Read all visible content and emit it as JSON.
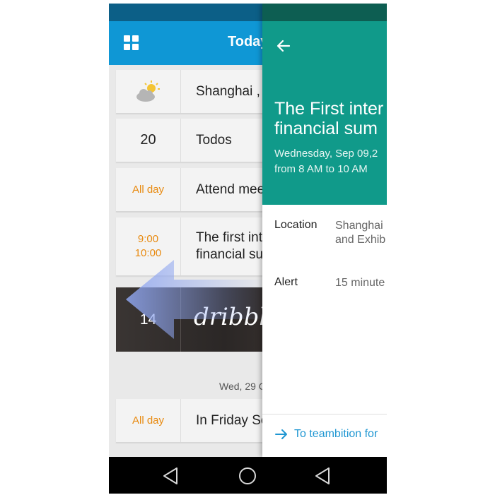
{
  "appbar": {
    "title": "Today"
  },
  "list": {
    "rows": [
      {
        "left": "",
        "right": "Shanghai ,"
      },
      {
        "left": "20",
        "right": "Todos"
      },
      {
        "left": "All day",
        "right": "Attend mee"
      },
      {
        "left_start": "9:00",
        "left_end": "10:00",
        "right_line1": "The first int",
        "right_line2": "financial su"
      },
      {
        "left": "14",
        "right": "dribbble"
      }
    ],
    "date_separator": "Wed, 29 C",
    "after_separator": [
      {
        "left": "All day",
        "right": "In Friday Se"
      }
    ]
  },
  "detail": {
    "title_line1": "The First inter",
    "title_line2": "financial  sum",
    "date_line1": "Wednesday, Sep 09,2",
    "date_line2": "from 8 AM to 10 AM",
    "location_label": "Location",
    "location_value_line1": "Shanghai",
    "location_value_line2": "and Exhib",
    "alert_label": "Alert",
    "alert_value": "15 minute",
    "link_label": "To teambition for"
  },
  "icons": {
    "grid": "grid-icon",
    "weather": "partly-cloudy-icon",
    "back": "arrow-left-icon",
    "swipe": "swipe-left-arrow-icon",
    "link_arrow": "arrow-right-icon",
    "nav_back": "triangle-back-icon",
    "nav_home": "circle-home-icon"
  },
  "colors": {
    "appbar": "#0f97d5",
    "statusbar": "#0c5f87",
    "detail_header": "#109a8a",
    "detail_status": "#0d5e52",
    "accent_orange": "#e88a10",
    "link_blue": "#1e96d2"
  }
}
